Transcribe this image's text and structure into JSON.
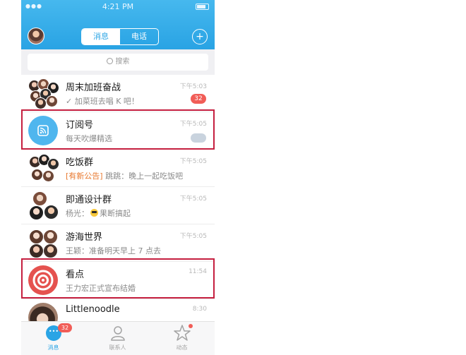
{
  "status_bar": {
    "time": "4:21 PM",
    "signal": "●●●"
  },
  "header": {
    "segments": [
      "消息",
      "电话"
    ],
    "active_segment": 0,
    "plus_label": "+"
  },
  "search": {
    "placeholder": "搜索"
  },
  "conversations": [
    {
      "name": "周末加班奋战",
      "preview": "✓ 加菜班去唱 K 吧！",
      "time": "下午5:03",
      "badge": "32",
      "avatar": "group-avatar"
    },
    {
      "name": "订阅号",
      "preview": "每天吹爆精选",
      "time": "下午5:05",
      "badge": "",
      "avatar": "subscription-avatar"
    },
    {
      "name": "吃饭群",
      "tag": "[有新公告]",
      "preview": "跳跳：晚上一起吃饭吧",
      "time": "下午5:05",
      "badge": "",
      "avatar": "group-avatar"
    },
    {
      "name": "即通设计群",
      "preview_prefix": "杨光：",
      "preview": "果断搞起",
      "time": "下午5:05",
      "badge": "",
      "avatar": "group-avatar"
    },
    {
      "name": "游海世界",
      "preview": "王颖：准备明天早上 7 点去",
      "time": "下午5:05",
      "badge": "",
      "avatar": "group-avatar"
    },
    {
      "name": "看点",
      "preview": "王力宏正式宣布结婚",
      "time": "11:54",
      "badge": "",
      "avatar": "kandian-avatar"
    },
    {
      "name": "Littlenoodle",
      "preview": "",
      "time": "8:30",
      "badge": "",
      "avatar": "user-avatar"
    }
  ],
  "tabbar": {
    "items": [
      {
        "label": "消息",
        "badge": "32"
      },
      {
        "label": "联系人",
        "badge": ""
      },
      {
        "label": "动态",
        "badge": ""
      }
    ]
  },
  "colors": {
    "accent": "#2aa4e5",
    "badge": "#f15d57",
    "highlight_border": "#c51f3f",
    "kandian": "#e5524f"
  }
}
